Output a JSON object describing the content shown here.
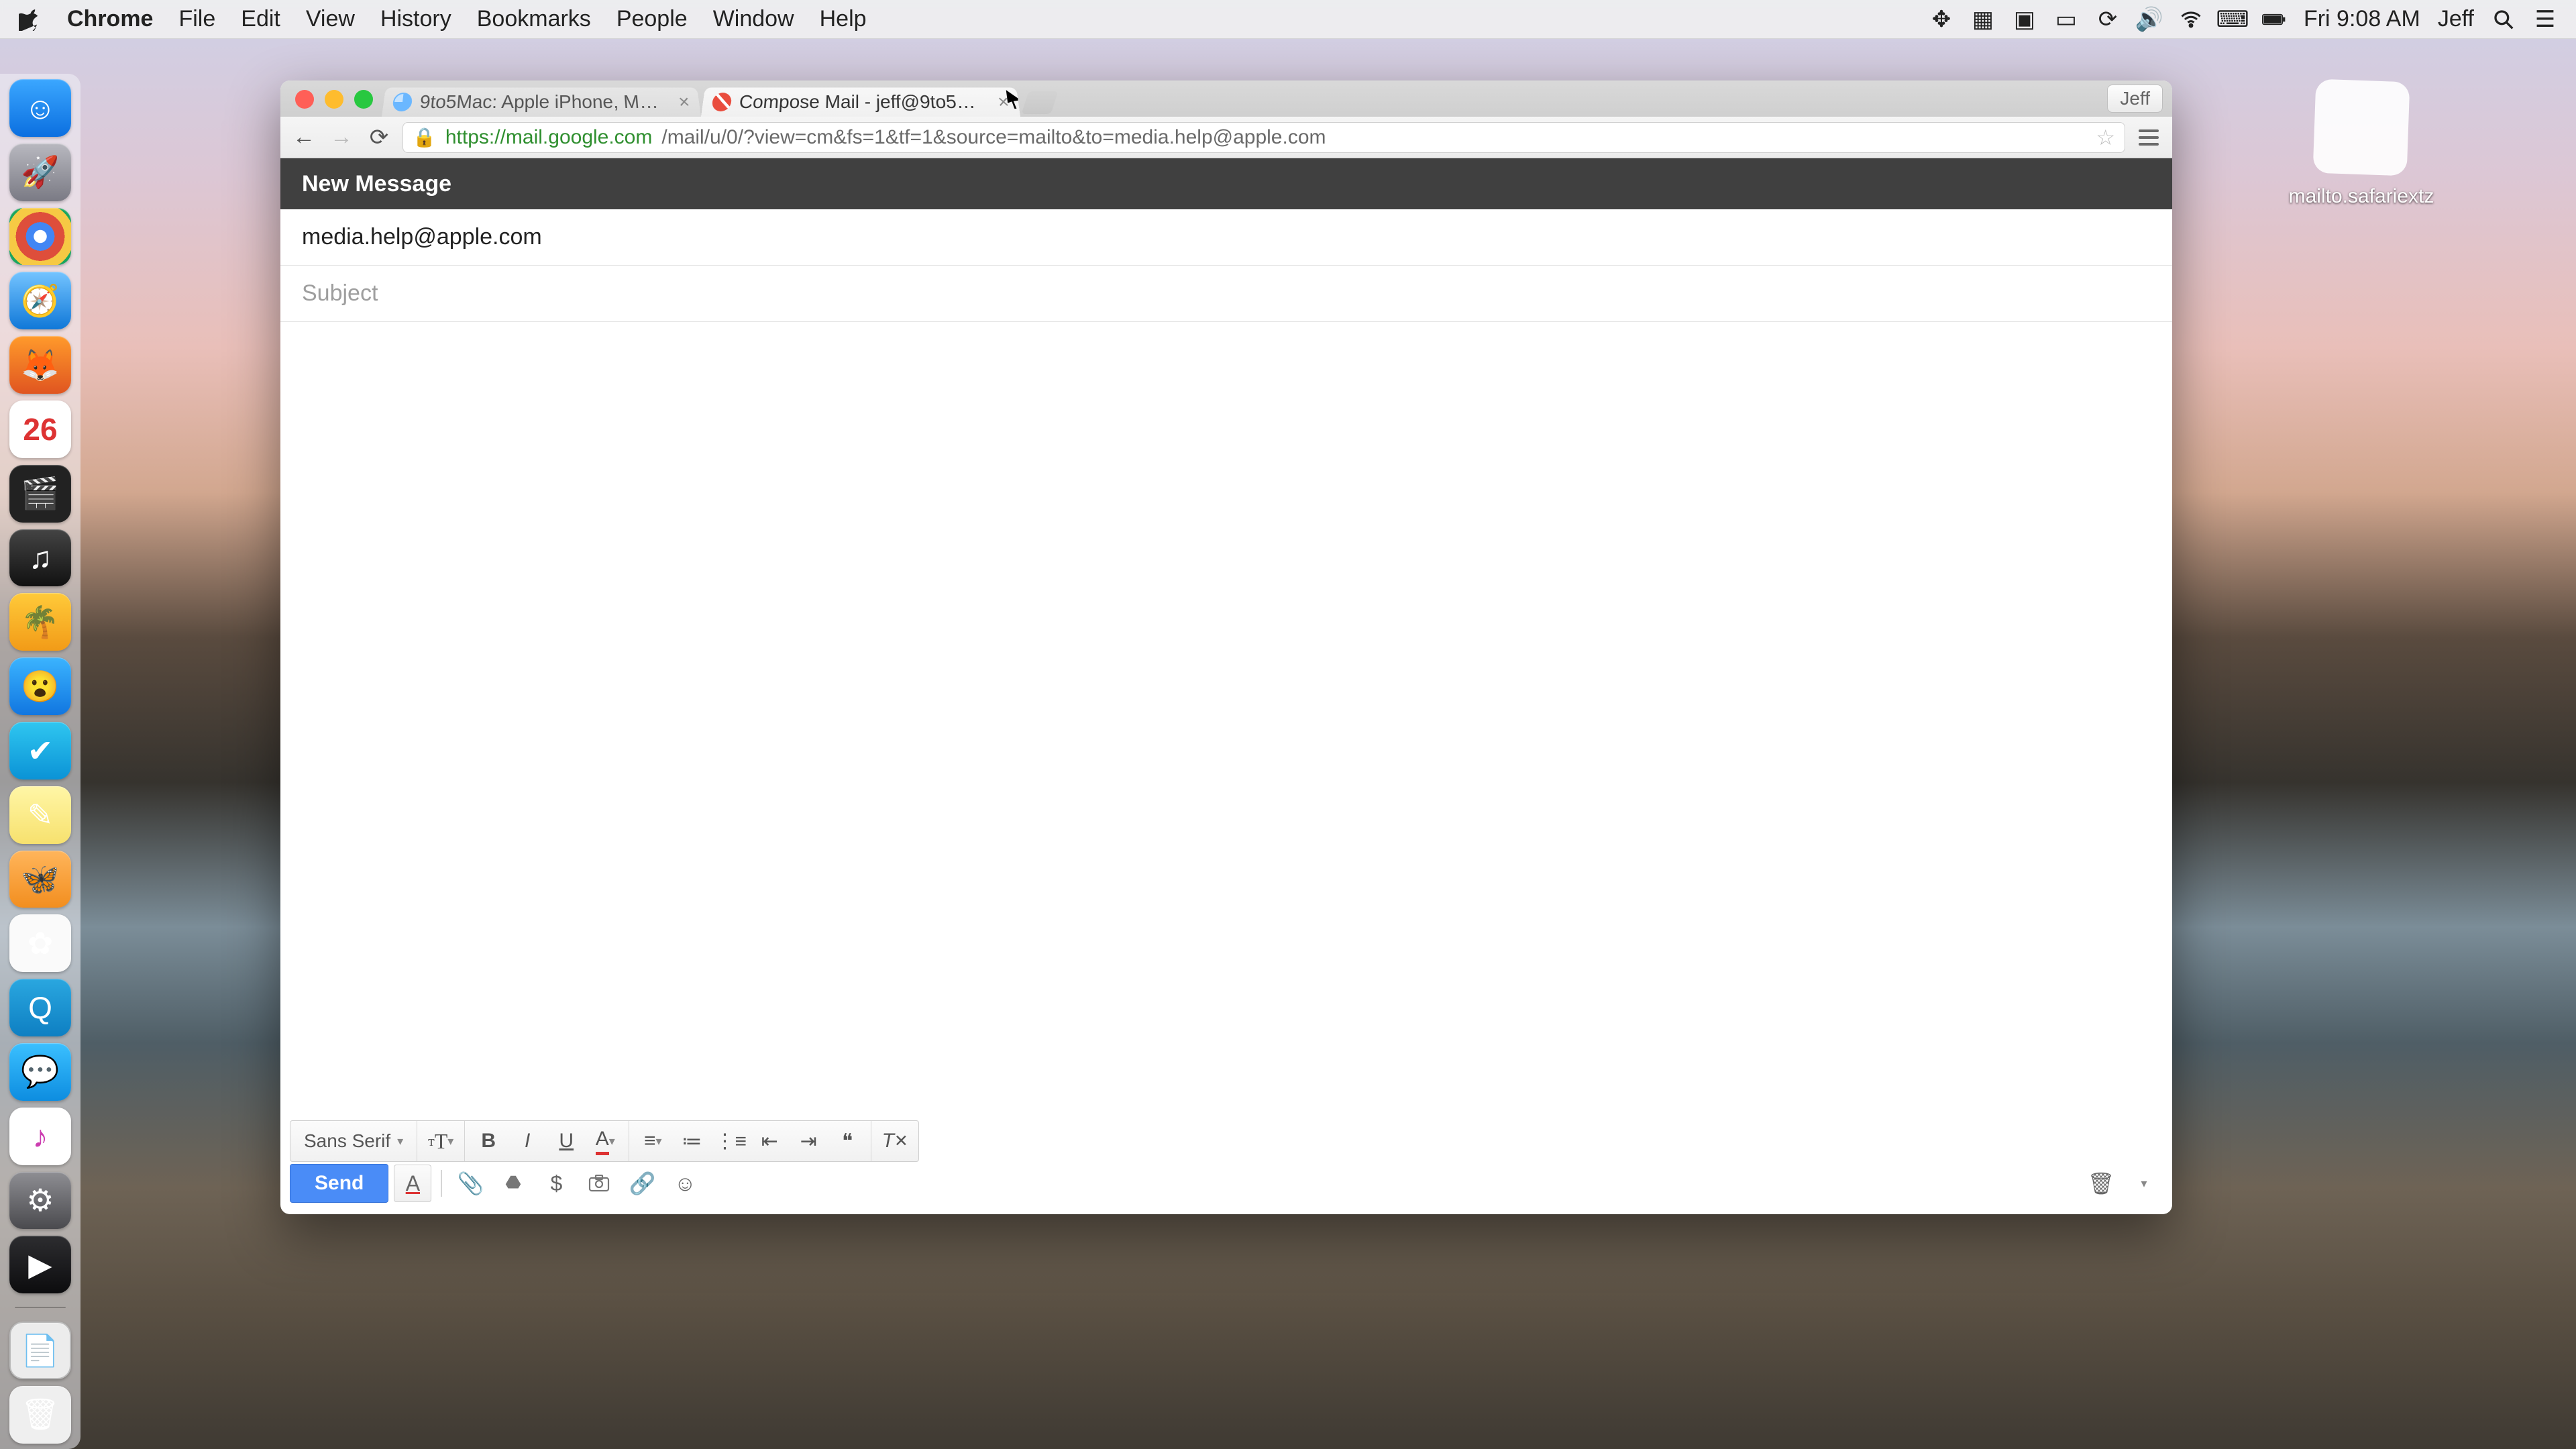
{
  "menubar": {
    "app": "Chrome",
    "items": [
      "File",
      "Edit",
      "View",
      "History",
      "Bookmarks",
      "People",
      "Window",
      "Help"
    ],
    "clock": "Fri 9:08 AM",
    "user": "Jeff"
  },
  "dock": {
    "calendar_day": "26"
  },
  "desktop_file": {
    "label": "mailto.safariextz"
  },
  "chrome": {
    "profile": "Jeff",
    "tabs": [
      {
        "title": "9to5Mac: Apple iPhone, M…"
      },
      {
        "title": "Compose Mail - jeff@9to5…"
      }
    ],
    "url_host": "https://mail.google.com",
    "url_rest": "/mail/u/0/?view=cm&fs=1&tf=1&source=mailto&to=media.help@apple.com"
  },
  "compose": {
    "header": "New Message",
    "to": "media.help@apple.com",
    "subject_placeholder": "Subject",
    "font": "Sans Serif",
    "send": "Send"
  }
}
